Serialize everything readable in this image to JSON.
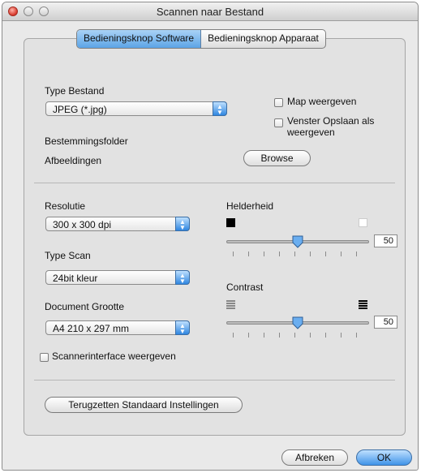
{
  "window": {
    "title": "Scannen naar Bestand"
  },
  "tabs": [
    {
      "label": "Bedieningsknop Software",
      "active": true
    },
    {
      "label": "Bedieningsknop Apparaat",
      "active": false
    }
  ],
  "file": {
    "type_label": "Type Bestand",
    "type_value": "JPEG (*.jpg)",
    "dest_label": "Bestemmingsfolder",
    "dest_value": "Afbeeldingen",
    "browse_label": "Browse",
    "show_map_label": "Map weergeven",
    "show_save_window_line1": "Venster Opslaan als",
    "show_save_window_line2": "weergeven"
  },
  "scan": {
    "resolution_label": "Resolutie",
    "resolution_value": "300 x 300 dpi",
    "type_label": "Type Scan",
    "type_value": "24bit kleur",
    "size_label": "Document Grootte",
    "size_value": "A4  210 x 297 mm",
    "scanner_iface_label": "Scannerinterface weergeven"
  },
  "brightness": {
    "label": "Helderheid",
    "value": "50",
    "level": 0.5
  },
  "contrast": {
    "label": "Contrast",
    "value": "50",
    "level": 0.5
  },
  "reset_label": "Terugzetten Standaard Instellingen",
  "buttons": {
    "cancel": "Afbreken",
    "ok": "OK"
  }
}
